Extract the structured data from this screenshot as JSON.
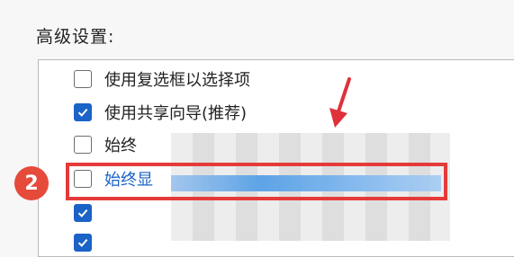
{
  "settings": {
    "section_title": "高级设置:",
    "options": [
      {
        "label": "使用复选框以选择项",
        "checked": false
      },
      {
        "label": "使用共享向导(推荐)",
        "checked": true
      },
      {
        "label": "始终",
        "checked": false
      },
      {
        "label": "始终显",
        "checked": false
      },
      {
        "label": "",
        "checked": true
      },
      {
        "label": "",
        "checked": true
      }
    ]
  },
  "annotation": {
    "step_number": "2",
    "highlight_color": "#e53a3a",
    "badge_color": "#e64a3a",
    "arrow_color": "#e0303a"
  },
  "colors": {
    "checkbox_checked": "#1b63c6",
    "background": "#f7f7f7"
  }
}
